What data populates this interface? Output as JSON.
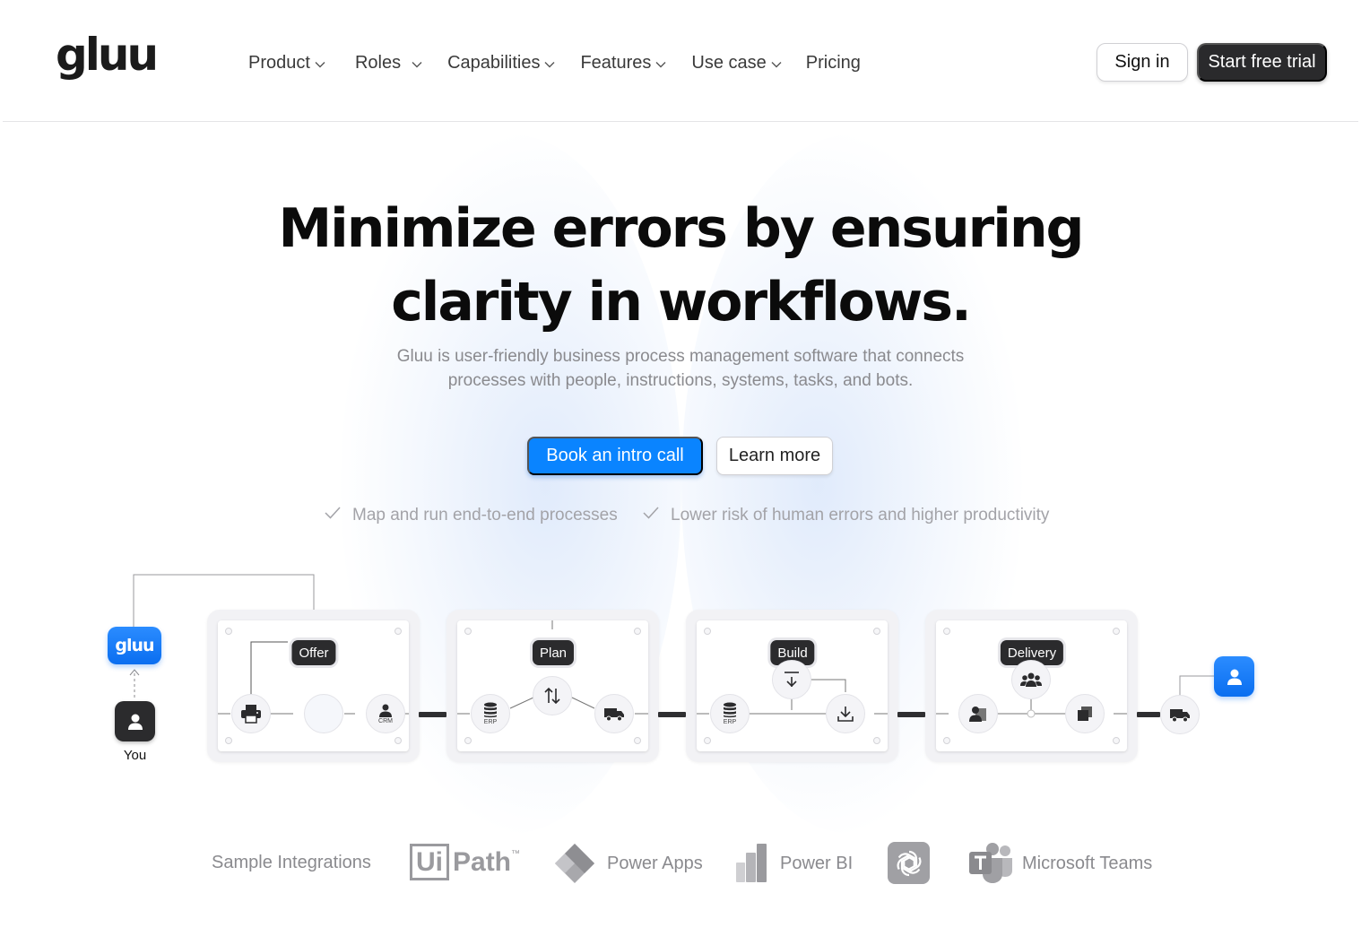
{
  "brand": {
    "logo_text": "gluu",
    "accent": "#0a84ff",
    "dark": "#2b2b2d"
  },
  "nav": {
    "items": [
      {
        "label": "Product",
        "has_dropdown": true
      },
      {
        "label": "Roles",
        "has_dropdown": true
      },
      {
        "label": "Capabilities",
        "has_dropdown": true
      },
      {
        "label": "Features",
        "has_dropdown": true
      },
      {
        "label": "Use case",
        "has_dropdown": true
      },
      {
        "label": "Pricing",
        "has_dropdown": false
      }
    ],
    "sign_in": "Sign in",
    "start_trial": "Start free trial"
  },
  "hero": {
    "title_line1": "Minimize errors by ensuring",
    "title_line2": "clarity in workflows.",
    "subtitle_line1": "Gluu is user-friendly business process management software that connects",
    "subtitle_line2": "processes with people, instructions, systems, tasks, and bots.",
    "primary_cta": "Book an intro call",
    "secondary_cta": "Learn more",
    "checks": [
      "Map and run end-to-end processes",
      "Lower risk of human errors and higher productivity"
    ]
  },
  "diagram": {
    "gluu_tile": "gluu",
    "you_label": "You",
    "stages": [
      {
        "label": "Offer",
        "nodes": [
          "printer-icon",
          "blank",
          "person-icon"
        ],
        "captions": [
          "",
          "",
          "CRM"
        ]
      },
      {
        "label": "Plan",
        "nodes": [
          "database-icon",
          "swap-arrows-icon",
          "truck-icon"
        ],
        "captions": [
          "ERP",
          "",
          ""
        ]
      },
      {
        "label": "Build",
        "nodes": [
          "database-icon",
          "upload-icon",
          "download-icon"
        ],
        "captions": [
          "ERP",
          "",
          ""
        ]
      },
      {
        "label": "Delivery",
        "nodes": [
          "person-doc-icon",
          "group-icon",
          "stack-icon"
        ],
        "captions": [
          "",
          "",
          ""
        ]
      }
    ]
  },
  "integrations": {
    "label": "Sample Integrations",
    "logos": [
      {
        "name": "UiPath",
        "ui": "Ui",
        "path": "Path",
        "tm": "™"
      },
      {
        "name": "Power Apps"
      },
      {
        "name": "Power BI"
      },
      {
        "name": "ChatGPT"
      },
      {
        "name": "Microsoft Teams"
      }
    ]
  }
}
